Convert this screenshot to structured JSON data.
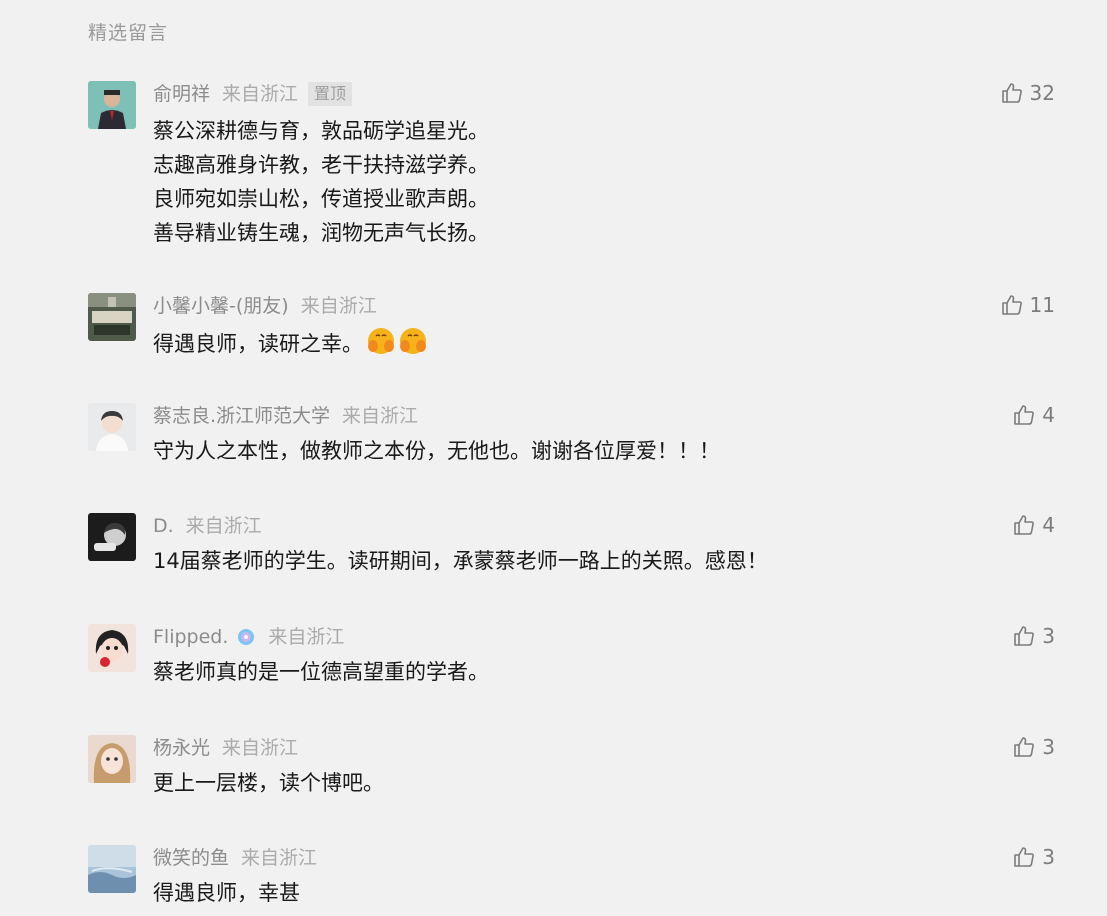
{
  "section_title": "精选留言",
  "pin_label": "置顶",
  "comments": [
    {
      "name": "俞明祥",
      "location": "来自浙江",
      "pinned": true,
      "likes": "32",
      "lines": [
        "蔡公深耕德与育，敦品砺学追星光。",
        "志趣高雅身许教，老干扶持滋学养。",
        "良师宛如崇山松，传道授业歌声朗。",
        "善导精业铸生魂，润物无声气长扬。"
      ]
    },
    {
      "name": "小馨小馨-(朋友)",
      "location": "来自浙江",
      "likes": "11",
      "lines": [
        "得遇良师，读研之幸。"
      ],
      "emoji": "hands-cheek-emoji"
    },
    {
      "name": "蔡志良.浙江师范大学",
      "location": "来自浙江",
      "likes": "4",
      "lines": [
        "守为人之本性，做教师之本份，无他也。谢谢各位厚爱！！！"
      ]
    },
    {
      "name": "D.",
      "location": "来自浙江",
      "likes": "4",
      "lines": [
        "14届蔡老师的学生。读研期间，承蒙蔡老师一路上的关照。感恩！"
      ]
    },
    {
      "name": "Flipped.",
      "location": "来自浙江",
      "likes": "3",
      "badge": "disc-badge-icon",
      "lines": [
        "蔡老师真的是一位德高望重的学者。"
      ]
    },
    {
      "name": "杨永光",
      "location": "来自浙江",
      "likes": "3",
      "lines": [
        "更上一层楼，读个博吧。"
      ]
    },
    {
      "name": "微笑的鱼",
      "location": "来自浙江",
      "likes": "3",
      "lines": [
        "得遇良师，幸甚"
      ]
    }
  ],
  "icons": {
    "like": "thumbs-up-icon"
  },
  "colors": {
    "background": "#f1f1f1",
    "meta": "#8c8c8c",
    "text": "#191919"
  }
}
